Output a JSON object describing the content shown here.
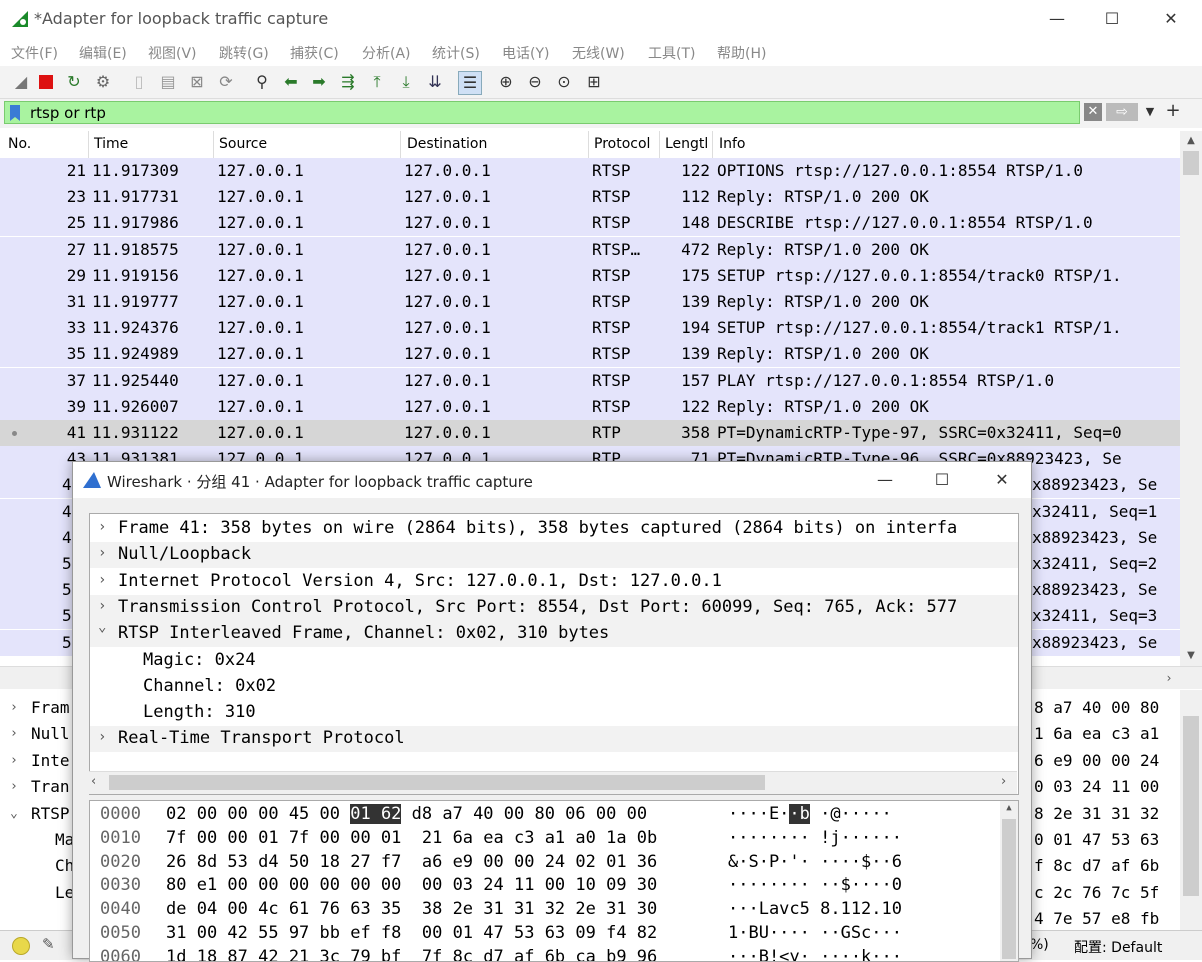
{
  "window": {
    "title": "*Adapter for loopback traffic capture",
    "minimize": "—",
    "maximize": "☐",
    "close": "✕"
  },
  "menu": [
    "文件(F)",
    "编辑(E)",
    "视图(V)",
    "跳转(G)",
    "捕获(C)",
    "分析(A)",
    "统计(S)",
    "电话(Y)",
    "无线(W)",
    "工具(T)",
    "帮助(H)"
  ],
  "filter": {
    "value": "rtsp or rtp"
  },
  "columns": [
    "No.",
    "Time",
    "Source",
    "Destination",
    "Protocol",
    "Lengtl",
    "Info"
  ],
  "packets": [
    {
      "no": "21",
      "time": "11.917309",
      "src": "127.0.0.1",
      "dst": "127.0.0.1",
      "proto": "RTSP",
      "len": "122",
      "info": "OPTIONS rtsp://127.0.0.1:8554 RTSP/1.0"
    },
    {
      "no": "23",
      "time": "11.917731",
      "src": "127.0.0.1",
      "dst": "127.0.0.1",
      "proto": "RTSP",
      "len": "112",
      "info": "Reply: RTSP/1.0 200 OK"
    },
    {
      "no": "25",
      "time": "11.917986",
      "src": "127.0.0.1",
      "dst": "127.0.0.1",
      "proto": "RTSP",
      "len": "148",
      "info": "DESCRIBE rtsp://127.0.0.1:8554 RTSP/1.0"
    },
    {
      "no": "27",
      "time": "11.918575",
      "src": "127.0.0.1",
      "dst": "127.0.0.1",
      "proto": "RTSP…",
      "len": "472",
      "info": "Reply: RTSP/1.0 200 OK"
    },
    {
      "no": "29",
      "time": "11.919156",
      "src": "127.0.0.1",
      "dst": "127.0.0.1",
      "proto": "RTSP",
      "len": "175",
      "info": "SETUP rtsp://127.0.0.1:8554/track0 RTSP/1."
    },
    {
      "no": "31",
      "time": "11.919777",
      "src": "127.0.0.1",
      "dst": "127.0.0.1",
      "proto": "RTSP",
      "len": "139",
      "info": "Reply: RTSP/1.0 200 OK"
    },
    {
      "no": "33",
      "time": "11.924376",
      "src": "127.0.0.1",
      "dst": "127.0.0.1",
      "proto": "RTSP",
      "len": "194",
      "info": "SETUP rtsp://127.0.0.1:8554/track1 RTSP/1."
    },
    {
      "no": "35",
      "time": "11.924989",
      "src": "127.0.0.1",
      "dst": "127.0.0.1",
      "proto": "RTSP",
      "len": "139",
      "info": "Reply: RTSP/1.0 200 OK"
    },
    {
      "no": "37",
      "time": "11.925440",
      "src": "127.0.0.1",
      "dst": "127.0.0.1",
      "proto": "RTSP",
      "len": "157",
      "info": "PLAY rtsp://127.0.0.1:8554 RTSP/1.0"
    },
    {
      "no": "39",
      "time": "11.926007",
      "src": "127.0.0.1",
      "dst": "127.0.0.1",
      "proto": "RTSP",
      "len": "122",
      "info": "Reply: RTSP/1.0 200 OK"
    },
    {
      "no": "41",
      "time": "11.931122",
      "src": "127.0.0.1",
      "dst": "127.0.0.1",
      "proto": "RTP",
      "len": "358",
      "info": "PT=DynamicRTP-Type-97, SSRC=0x32411, Seq=0"
    },
    {
      "no": "43",
      "time": "11.931381",
      "src": "127.0.0.1",
      "dst": "127.0.0.1",
      "proto": "RTP",
      "len": "71",
      "info": "PT=DynamicRTP-Type-96, SSRC=0x88923423, Se"
    }
  ],
  "hidden_info_tails": [
    "x88923423, Se",
    "x32411, Seq=1",
    "x88923423, Se",
    "x32411, Seq=2",
    "x88923423, Se",
    "x32411, Seq=3",
    "x88923423, Se"
  ],
  "hidden_nos": [
    "4",
    "4",
    "4",
    "5",
    "5",
    "5",
    "5"
  ],
  "bg_detail": [
    "Fram",
    "Null",
    "Inte",
    "Tran",
    "RTSP",
    "Ma",
    "Ch",
    "Le"
  ],
  "bg_bytes": [
    "8 a7 40 00 80",
    "1 6a ea c3 a1",
    "6 e9 00 00 24",
    "0 03 24 11 00",
    "8 2e 31 31 32",
    "0 01 47 53 63",
    "f 8c d7 af 6b",
    "c 2c 76 7c 5f",
    "4 7e 57 e8 fb"
  ],
  "status": {
    "tail": "%)",
    "profile": "配置: Default"
  },
  "dialog": {
    "title": "Wireshark · 分组 41 · Adapter for loopback traffic capture",
    "tree": [
      {
        "text": "Frame 41: 358 bytes on wire (2864 bits), 358 bytes captured (2864 bits) on interfa",
        "indent": 0,
        "arrow": ">"
      },
      {
        "text": "Null/Loopback",
        "indent": 0,
        "arrow": ">"
      },
      {
        "text": "Internet Protocol Version 4, Src: 127.0.0.1, Dst: 127.0.0.1",
        "indent": 0,
        "arrow": ">"
      },
      {
        "text": "Transmission Control Protocol, Src Port: 8554, Dst Port: 60099, Seq: 765, Ack: 577",
        "indent": 0,
        "arrow": ">"
      },
      {
        "text": "RTSP Interleaved Frame, Channel: 0x02, 310 bytes",
        "indent": 0,
        "arrow": "v"
      },
      {
        "text": "Magic: 0x24",
        "indent": 1,
        "arrow": ""
      },
      {
        "text": "Channel: 0x02",
        "indent": 1,
        "arrow": ""
      },
      {
        "text": "Length: 310",
        "indent": 1,
        "arrow": ""
      },
      {
        "text": "Real-Time Transport Protocol",
        "indent": 0,
        "arrow": ">"
      }
    ],
    "bytes": [
      {
        "off": "0000",
        "hex": [
          "02 00 00 00 45 00 ",
          "01 62",
          " d8 a7 40 00 80 06 00 00"
        ],
        "ascii": [
          "····E·",
          "·b",
          " ·@·····"
        ]
      },
      {
        "off": "0010",
        "hex": [
          "7f 00 00 01 7f 00 00 01  21 6a ea c3 a1 a0 1a 0b"
        ],
        "ascii": [
          "········ !j······"
        ]
      },
      {
        "off": "0020",
        "hex": [
          "26 8d 53 d4 50 18 27 f7  a6 e9 00 00 24 02 01 36"
        ],
        "ascii": [
          "&·S·P·'· ····$··6"
        ]
      },
      {
        "off": "0030",
        "hex": [
          "80 e1 00 00 00 00 00 00  00 03 24 11 00 10 09 30"
        ],
        "ascii": [
          "········ ··$····0"
        ]
      },
      {
        "off": "0040",
        "hex": [
          "de 04 00 4c 61 76 63 35  38 2e 31 31 32 2e 31 30"
        ],
        "ascii": [
          "···Lavc5 8.112.10"
        ]
      },
      {
        "off": "0050",
        "hex": [
          "31 00 42 55 97 bb ef f8  00 01 47 53 63 09 f4 82"
        ],
        "ascii": [
          "1·BU···· ··GSc···"
        ]
      },
      {
        "off": "0060",
        "hex": [
          "1d 18 87 42 21 3c 79 bf  7f 8c d7 af 6b ca b9 96"
        ],
        "ascii": [
          "···B!<y· ····k···"
        ]
      }
    ]
  }
}
